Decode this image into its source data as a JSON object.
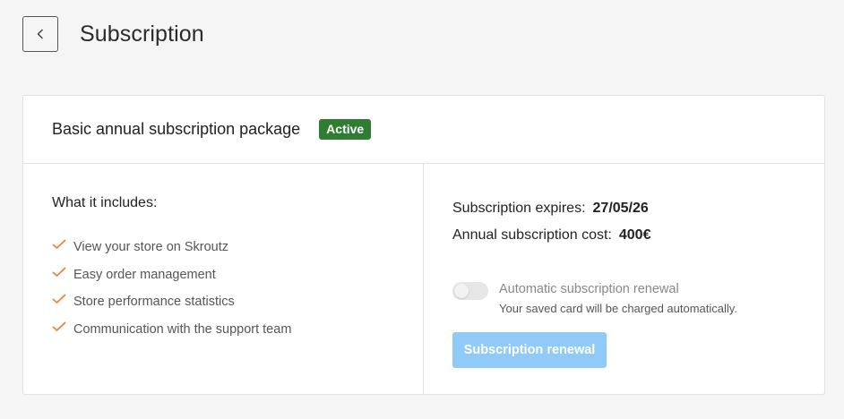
{
  "header": {
    "back_icon": "chevron-left-icon",
    "title": "Subscription"
  },
  "package": {
    "name": "Basic annual subscription package",
    "status": "Active",
    "status_color": "#2e7d32"
  },
  "includes": {
    "title": "What it includes:",
    "check_color": "#e8843a",
    "items": [
      "View your store on Skroutz",
      "Easy order management",
      "Store performance statistics",
      "Communication with the support team"
    ]
  },
  "subscription": {
    "expires_label": "Subscription expires:",
    "expires_value": "27/05/26",
    "cost_label": "Annual subscription cost:",
    "cost_value": "400€"
  },
  "renewal": {
    "toggle_on": false,
    "label": "Automatic subscription renewal",
    "hint": "Your saved card will be charged automatically.",
    "button_label": "Subscription renewal",
    "button_color": "#90caf9"
  }
}
